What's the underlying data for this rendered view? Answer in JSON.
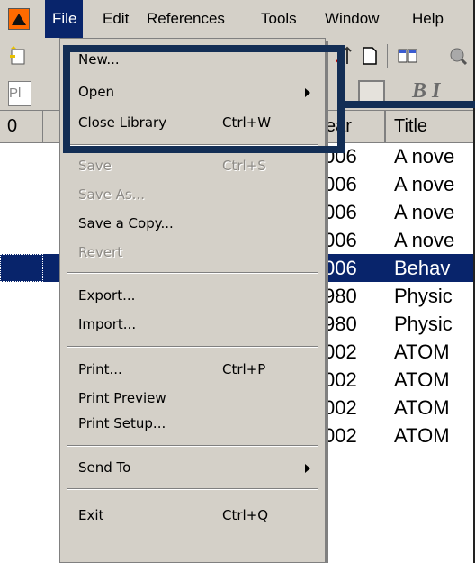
{
  "menubar": {
    "items": [
      "File",
      "Edit",
      "References",
      "Tools",
      "Window",
      "Help"
    ],
    "active": "File"
  },
  "toolbar": {
    "search_stub": "Pl",
    "format_text": "B  I"
  },
  "table": {
    "headers": {
      "attach": "0",
      "year": "ear",
      "title": "Title"
    },
    "rows": [
      {
        "year": "006",
        "title": "A nove"
      },
      {
        "year": "006",
        "title": "A nove"
      },
      {
        "year": "006",
        "title": "A nove"
      },
      {
        "year": "006",
        "title": "A nove"
      },
      {
        "year": "006",
        "title": "Behav",
        "selected": true
      },
      {
        "year": "980",
        "title": "Physic"
      },
      {
        "year": "980",
        "title": "Physic"
      },
      {
        "year": "002",
        "title": "ATOM"
      },
      {
        "year": "002",
        "title": "ATOM"
      },
      {
        "year": "002",
        "title": "ATOM"
      },
      {
        "year": "002",
        "title": "ATOM"
      }
    ]
  },
  "file_menu": {
    "new": {
      "label": "New..."
    },
    "open": {
      "label": "Open"
    },
    "close_library": {
      "label": "Close Library",
      "shortcut": "Ctrl+W"
    },
    "save": {
      "label": "Save",
      "shortcut": "Ctrl+S",
      "disabled": true
    },
    "save_as": {
      "label": "Save As...",
      "disabled": true
    },
    "save_copy": {
      "label": "Save a Copy..."
    },
    "revert": {
      "label": "Revert",
      "disabled": true
    },
    "export": {
      "label": "Export..."
    },
    "import": {
      "label": "Import..."
    },
    "print": {
      "label": "Print...",
      "shortcut": "Ctrl+P"
    },
    "print_preview": {
      "label": "Print Preview"
    },
    "print_setup": {
      "label": "Print Setup..."
    },
    "send_to": {
      "label": "Send To"
    },
    "exit": {
      "label": "Exit",
      "shortcut": "Ctrl+Q"
    }
  },
  "colors": {
    "menu_bg": "#d4d0c8",
    "selection": "#08246b",
    "highlight_box": "#132e55",
    "disabled_text": "#8e8b86"
  },
  "icons": [
    "app-logo-icon",
    "new-reference-icon",
    "sort-icon",
    "document-icon",
    "columns-icon",
    "search-globe-icon"
  ]
}
